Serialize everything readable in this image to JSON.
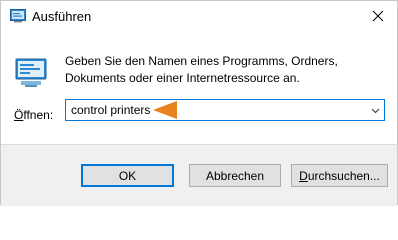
{
  "window": {
    "title": "Ausführen",
    "close_icon": "close-icon"
  },
  "main": {
    "description": "Geben Sie den Namen eines Programms, Ordners, Dokuments oder einer Internetressource an.",
    "open_label_prefix": "Ö",
    "open_label_rest": "ffnen:",
    "input_value": "control printers",
    "dropdown_icon": "chevron-down-icon"
  },
  "buttons": {
    "ok": "OK",
    "cancel": "Abbrechen",
    "browse_prefix": "D",
    "browse_rest": "urchsuchen..."
  },
  "annotation": {
    "arrow_color": "#f0962a"
  }
}
